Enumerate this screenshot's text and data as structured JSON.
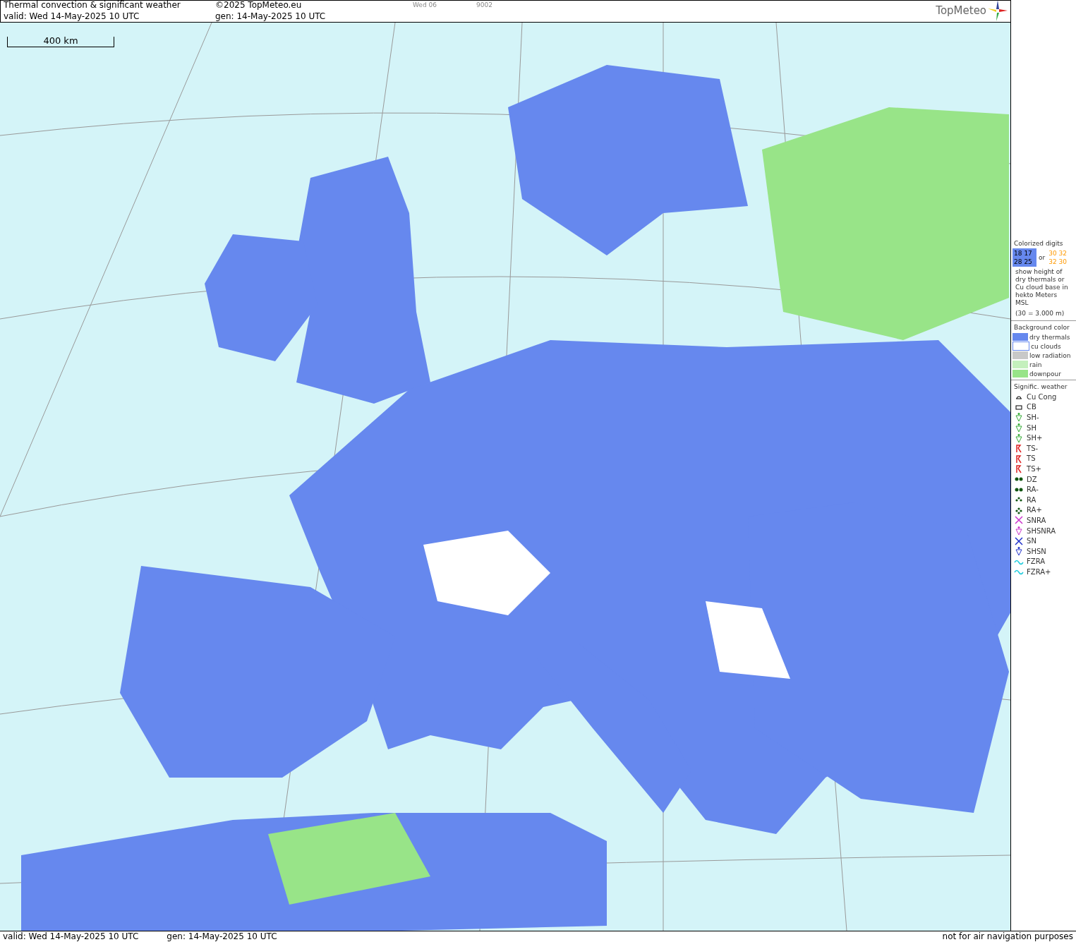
{
  "header": {
    "title": "Thermal convection & significant weather",
    "copyright": "©2025 TopMeteo.eu",
    "day_code": "Wed 06",
    "code": "9002",
    "valid": "valid:  Wed  14-May-2025  10 UTC",
    "gen": "gen: 14-May-2025 10 UTC"
  },
  "logo": {
    "text": "TopMeteo"
  },
  "map": {
    "scale": "400 km"
  },
  "legend": {
    "digits_title": "Colorized digits",
    "samples": [
      {
        "kind": "dry",
        "top": "18 17",
        "bottom": "28 25"
      },
      {
        "kind": "cu",
        "top": "30 32",
        "bottom": "32 30"
      }
    ],
    "or": "or",
    "description": "show height of dry thermals or Cu cloud base in hekto Meters MSL",
    "example": "(30 = 3.000 m)",
    "background_title": "Background color",
    "backgrounds": [
      {
        "label": "dry thermals",
        "color": "#6688ee"
      },
      {
        "label": "cu clouds",
        "color": "#ffffff"
      },
      {
        "label": "low radiation",
        "color": "#c8c8c8"
      },
      {
        "label": "rain",
        "color": "#c4f0bc"
      },
      {
        "label": "downpour",
        "color": "#98e488"
      }
    ],
    "weather_title": "Signific. weather",
    "weather": [
      {
        "label": "Cu Cong",
        "kind": "cucong"
      },
      {
        "label": "CB",
        "kind": "cb"
      },
      {
        "label": "SH-",
        "kind": "sh1"
      },
      {
        "label": "SH",
        "kind": "sh2"
      },
      {
        "label": "SH+",
        "kind": "sh3"
      },
      {
        "label": "TS-",
        "kind": "ts1"
      },
      {
        "label": "TS",
        "kind": "ts2"
      },
      {
        "label": "TS+",
        "kind": "ts3"
      },
      {
        "label": "DZ",
        "kind": "dz"
      },
      {
        "label": "RA-",
        "kind": "ra1"
      },
      {
        "label": "RA",
        "kind": "ra2"
      },
      {
        "label": "RA+",
        "kind": "ra3"
      },
      {
        "label": "SNRA",
        "kind": "snra"
      },
      {
        "label": "SHSNRA",
        "kind": "shsnra"
      },
      {
        "label": "SN",
        "kind": "sn"
      },
      {
        "label": "SHSN",
        "kind": "shsn"
      },
      {
        "label": "FZRA",
        "kind": "fzra"
      },
      {
        "label": "FZRA+",
        "kind": "fzra2"
      }
    ]
  },
  "footer": {
    "valid": "valid:  Wed  14-May-2025  10 UTC",
    "gen": "gen: 14-May-2025 10 UTC",
    "note": "not for air navigation purposes"
  }
}
